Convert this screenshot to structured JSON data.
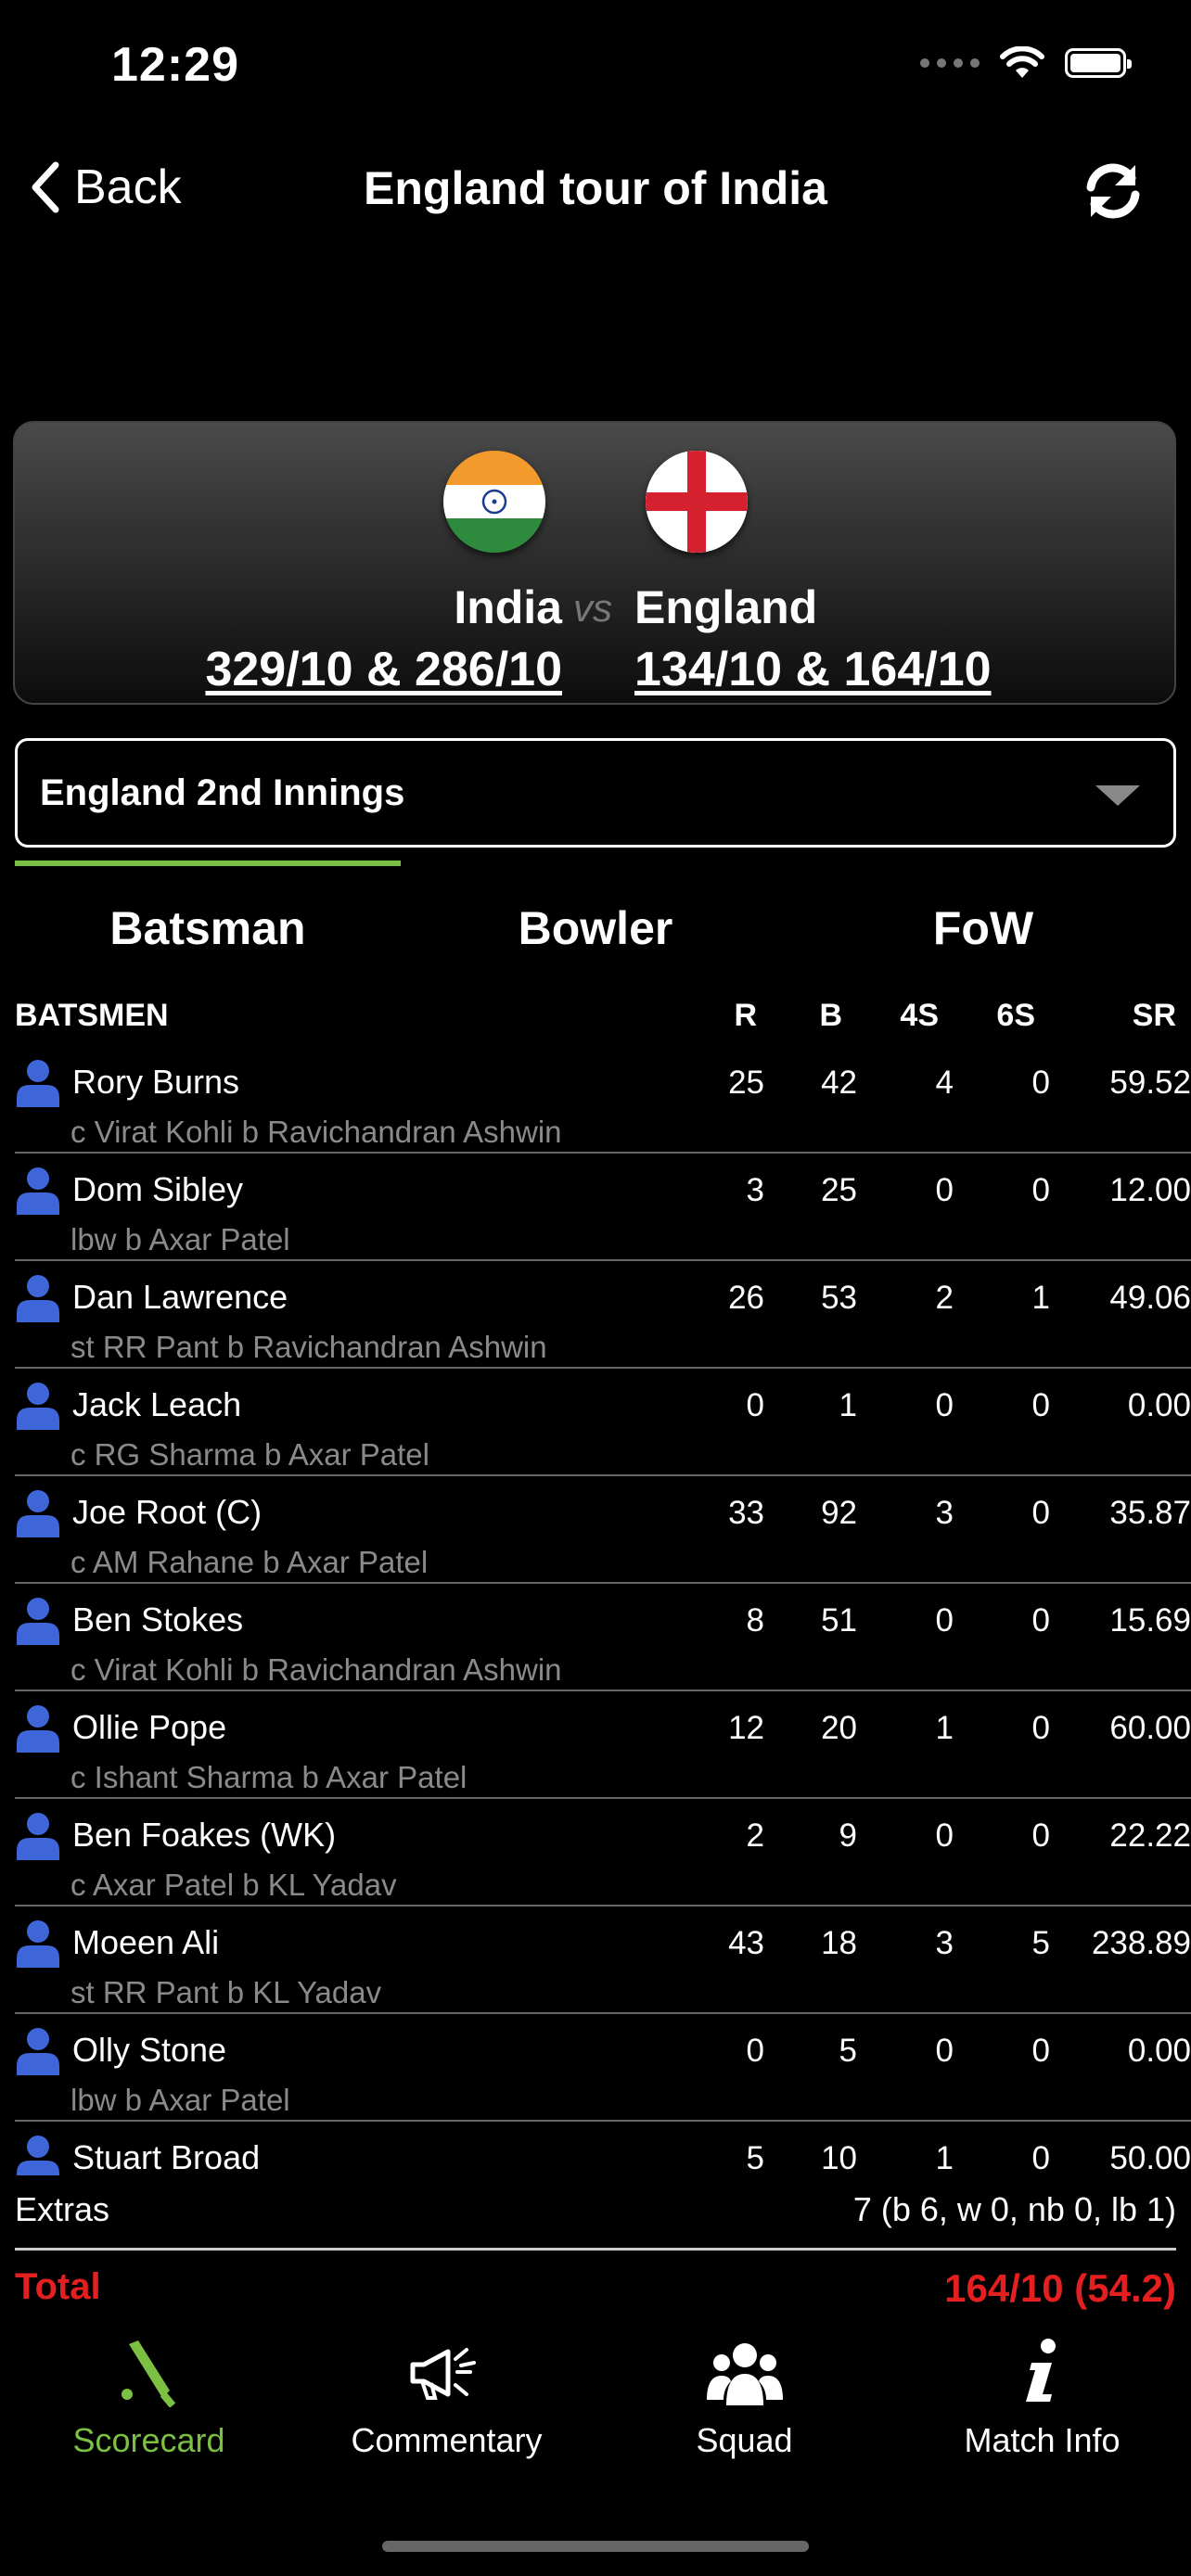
{
  "status": {
    "time": "12:29"
  },
  "nav": {
    "back_label": "Back",
    "title": "England tour of India"
  },
  "match": {
    "team1": "India",
    "team1_score": "329/10 & 286/10",
    "vs": "vs",
    "team2": "England",
    "team2_score": "134/10 & 164/10"
  },
  "innings_select": {
    "value": "England 2nd Innings"
  },
  "tabs": [
    "Batsman",
    "Bowler",
    "FoW"
  ],
  "table_header": {
    "name": "BATSMEN",
    "r": "R",
    "b": "B",
    "fours": "4S",
    "sixes": "6S",
    "sr": "SR"
  },
  "batsmen": [
    {
      "name": "Rory Burns",
      "dismissal": "c Virat Kohli b Ravichandran Ashwin",
      "r": "25",
      "b": "42",
      "fours": "4",
      "sixes": "0",
      "sr": "59.52"
    },
    {
      "name": "Dom Sibley",
      "dismissal": "lbw b Axar Patel",
      "r": "3",
      "b": "25",
      "fours": "0",
      "sixes": "0",
      "sr": "12.00"
    },
    {
      "name": "Dan Lawrence",
      "dismissal": "st RR Pant b Ravichandran Ashwin",
      "r": "26",
      "b": "53",
      "fours": "2",
      "sixes": "1",
      "sr": "49.06"
    },
    {
      "name": "Jack Leach",
      "dismissal": "c RG Sharma b Axar Patel",
      "r": "0",
      "b": "1",
      "fours": "0",
      "sixes": "0",
      "sr": "0.00"
    },
    {
      "name": "Joe Root  (C)",
      "dismissal": "c AM Rahane b Axar Patel",
      "r": "33",
      "b": "92",
      "fours": "3",
      "sixes": "0",
      "sr": "35.87"
    },
    {
      "name": "Ben Stokes",
      "dismissal": "c Virat Kohli b Ravichandran Ashwin",
      "r": "8",
      "b": "51",
      "fours": "0",
      "sixes": "0",
      "sr": "15.69"
    },
    {
      "name": "Ollie Pope",
      "dismissal": "c Ishant Sharma b Axar Patel",
      "r": "12",
      "b": "20",
      "fours": "1",
      "sixes": "0",
      "sr": "60.00"
    },
    {
      "name": "Ben Foakes  (WK)",
      "dismissal": "c Axar Patel b KL Yadav",
      "r": "2",
      "b": "9",
      "fours": "0",
      "sixes": "0",
      "sr": "22.22"
    },
    {
      "name": "Moeen Ali",
      "dismissal": "st RR Pant b KL Yadav",
      "r": "43",
      "b": "18",
      "fours": "3",
      "sixes": "5",
      "sr": "238.89"
    },
    {
      "name": "Olly Stone",
      "dismissal": "lbw b Axar Patel",
      "r": "0",
      "b": "5",
      "fours": "0",
      "sixes": "0",
      "sr": "0.00"
    },
    {
      "name": "Stuart Broad",
      "dismissal": "",
      "r": "5",
      "b": "10",
      "fours": "1",
      "sixes": "0",
      "sr": "50.00"
    }
  ],
  "extras": {
    "label": "Extras",
    "value": "7 (b 6, w 0, nb 0, lb 1)"
  },
  "total": {
    "label": "Total",
    "value": "164/10 (54.2)"
  },
  "bottom_nav": [
    {
      "label": "Scorecard",
      "icon": "cricket-bat-icon",
      "active": true
    },
    {
      "label": "Commentary",
      "icon": "megaphone-icon",
      "active": false
    },
    {
      "label": "Squad",
      "icon": "group-icon",
      "active": false
    },
    {
      "label": "Match Info",
      "icon": "info-icon",
      "active": false
    }
  ],
  "colors": {
    "accent": "#7cc043",
    "avatar": "#3f66d8",
    "total": "#e41f1f"
  }
}
